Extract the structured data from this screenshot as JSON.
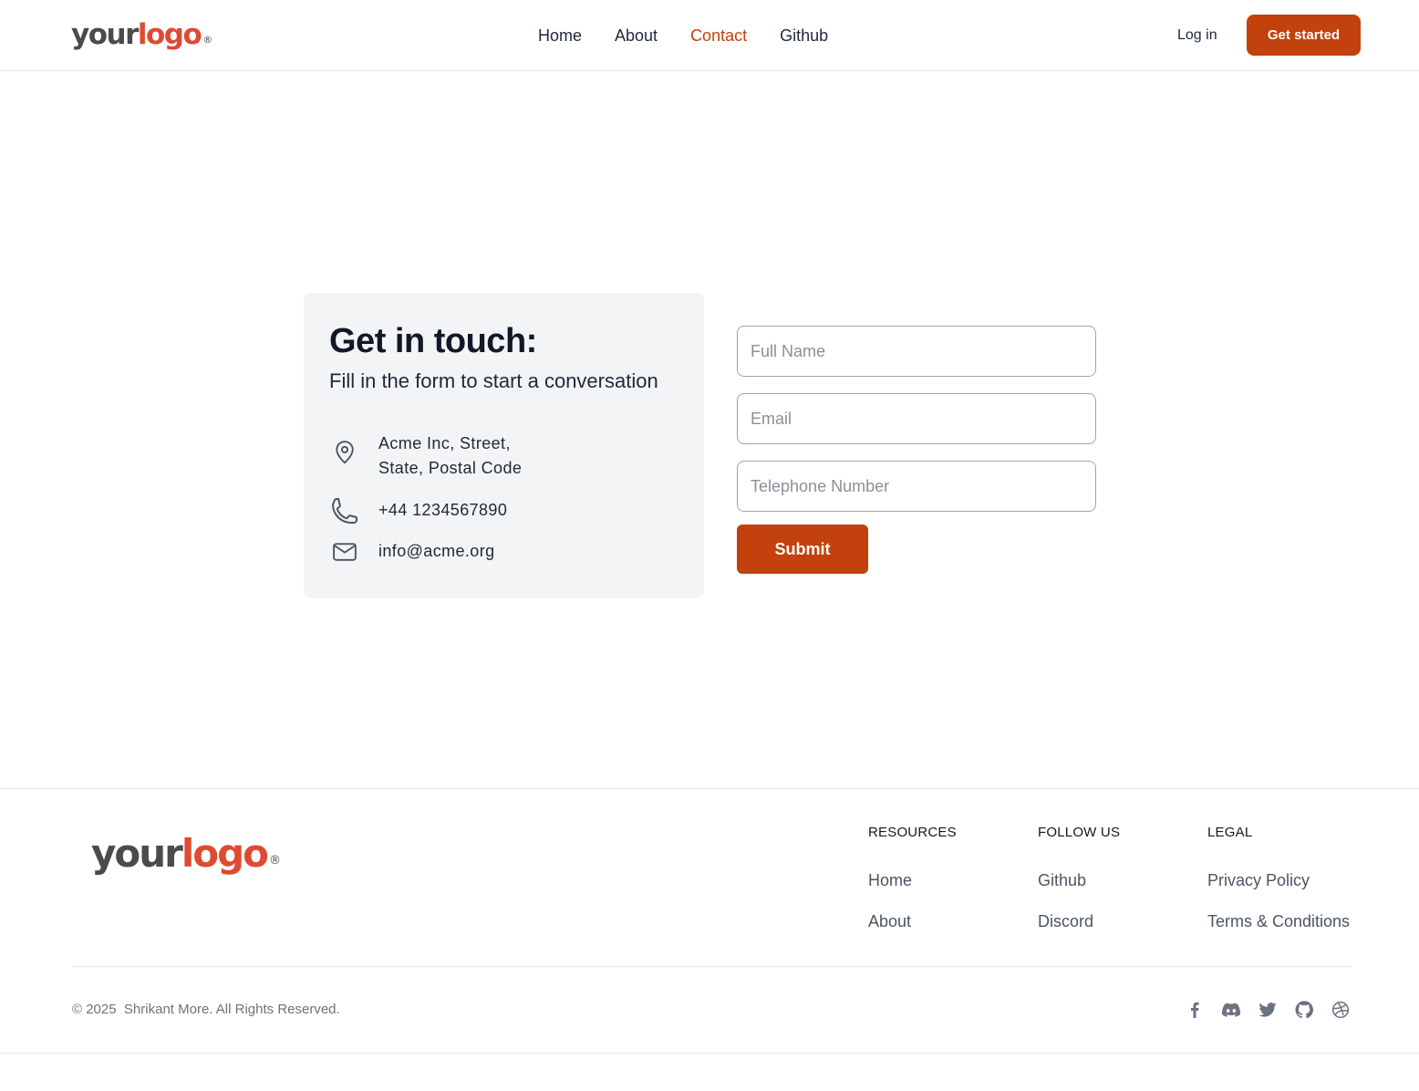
{
  "brand": {
    "logo_word1": "your",
    "logo_word2": "logo",
    "logo_mark": "®",
    "accent_color": "#c2410c",
    "logo_color": "#e04a32"
  },
  "nav": {
    "items": [
      "Home",
      "About",
      "Contact",
      "Github"
    ],
    "active": "Contact",
    "login_label": "Log in",
    "cta_label": "Get started"
  },
  "contact": {
    "title": "Get in touch:",
    "subtitle": "Fill in the form to start a conversation",
    "address_line1": "Acme Inc, Street,",
    "address_line2": "State, Postal Code",
    "phone": "+44 1234567890",
    "email": "info@acme.org",
    "icons": [
      "location-pin-icon",
      "phone-icon",
      "mail-icon"
    ]
  },
  "form": {
    "name_placeholder": "Full Name",
    "email_placeholder": "Email",
    "phone_placeholder": "Telephone Number",
    "submit_label": "Submit"
  },
  "footer": {
    "columns": [
      {
        "heading": "RESOURCES",
        "links": [
          "Home",
          "About"
        ]
      },
      {
        "heading": "FOLLOW US",
        "links": [
          "Github",
          "Discord"
        ]
      },
      {
        "heading": "LEGAL",
        "links": [
          "Privacy Policy",
          "Terms & Conditions"
        ]
      }
    ],
    "copyright": "© 2025  Shrikant More. All Rights Reserved.",
    "socials": [
      "facebook-icon",
      "discord-icon",
      "twitter-icon",
      "github-icon",
      "dribbble-icon"
    ]
  }
}
